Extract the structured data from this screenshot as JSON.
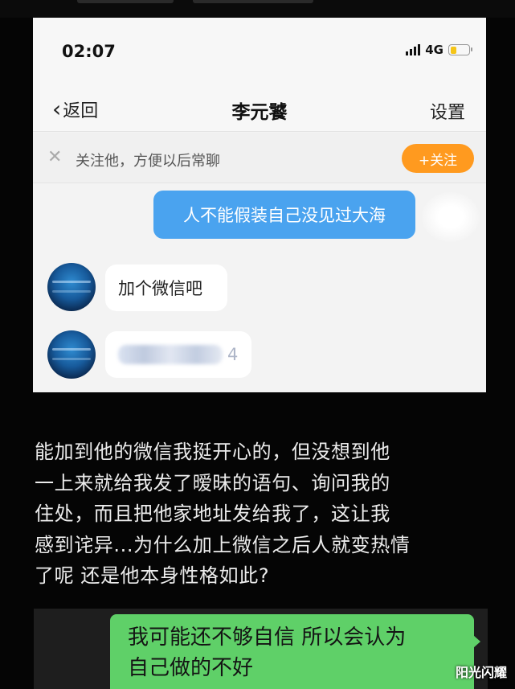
{
  "status_bar": {
    "time": "02:07",
    "network": "4G"
  },
  "nav": {
    "back_label": "返回",
    "title": "李元饕",
    "settings_label": "设置"
  },
  "follow_bar": {
    "text": "关注他，方便以后常聊",
    "button_label": "+关注"
  },
  "chat": {
    "outgoing": "人不能假装自己没见过大海",
    "incoming": [
      "加个微信吧",
      "4"
    ]
  },
  "story": {
    "lines": [
      "能加到他的微信我挺开心的，但没想到他",
      "一上来就给我发了暧昧的语句、询问我的",
      "住处，而且把他家地址发给我了，这让我",
      "感到诧异...为什么加上微信之后人就变热情",
      "了呢 还是他本身性格如此?"
    ]
  },
  "reply_bubble": {
    "lines": [
      "我可能还不够自信 所以会认为",
      "自己做的不好"
    ]
  },
  "watermark": "阳光闪耀",
  "colors": {
    "outgoing_bubble": "#4aa3ef",
    "follow_button": "#ff9a1f",
    "reply_bubble": "#5fd068",
    "background": "#050505"
  }
}
